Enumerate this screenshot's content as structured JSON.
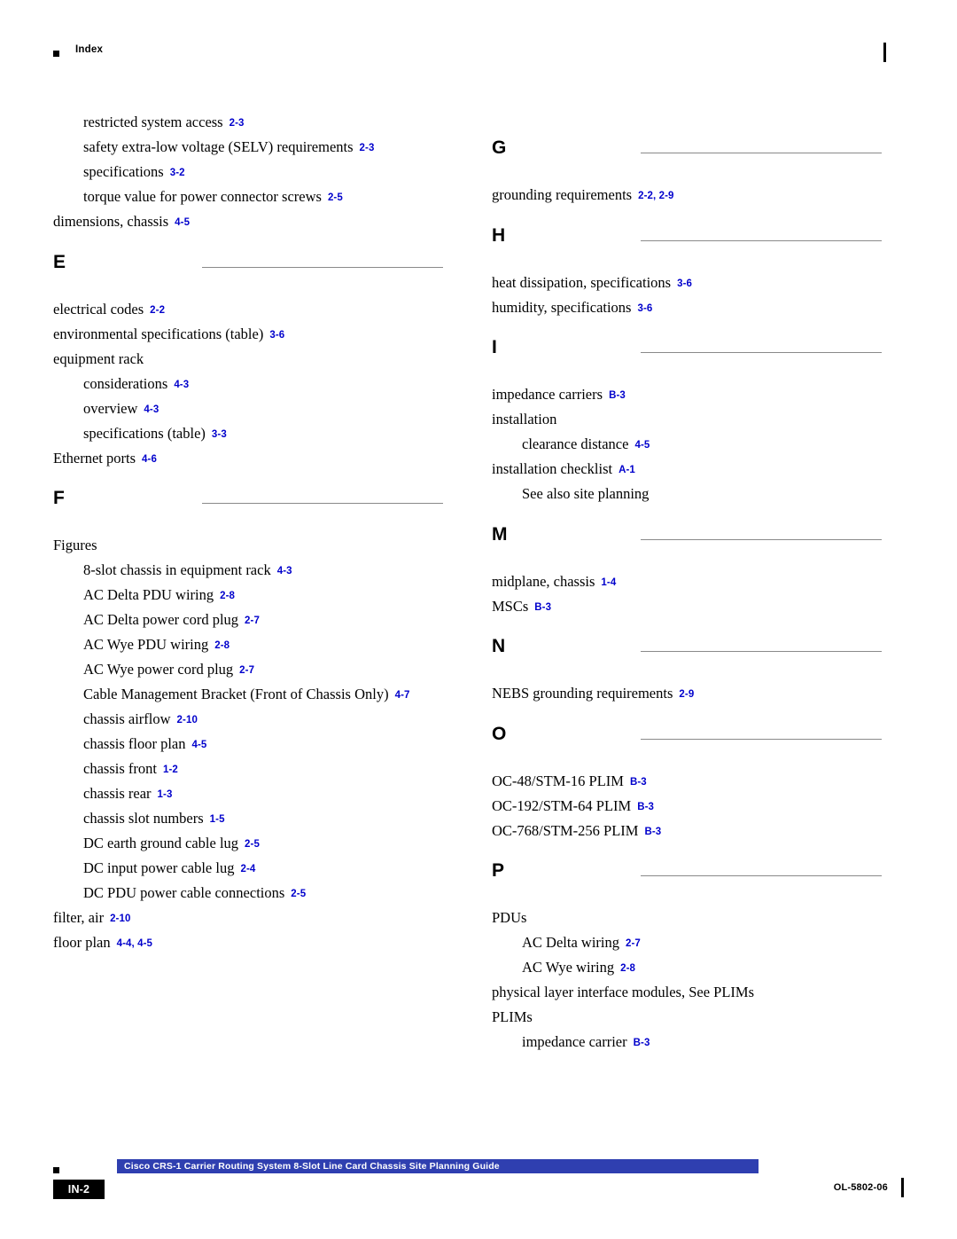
{
  "header": {
    "title": "Index"
  },
  "footer": {
    "bar_title": "Cisco CRS-1 Carrier Routing System 8-Slot Line Card Chassis Site Planning Guide",
    "page_badge": "IN-2",
    "doc_id": "OL-5802-06"
  },
  "colors": {
    "page_ref": "#0000CC",
    "footer_bar": "#2f3fb0",
    "rule": "#8a8a8a"
  },
  "left_column": {
    "continued_entries": [
      {
        "text": "restricted system access",
        "page": "2-3",
        "level": 1
      },
      {
        "text": "safety extra-low voltage (SELV) requirements",
        "page": "2-3",
        "level": 1
      },
      {
        "text": "specifications",
        "page": "3-2",
        "level": 1
      },
      {
        "text": "torque value for power connector screws",
        "page": "2-5",
        "level": 1
      },
      {
        "text": "dimensions, chassis",
        "page": "4-5",
        "level": 0
      }
    ],
    "sections": [
      {
        "letter": "E",
        "entries": [
          {
            "text": "electrical codes",
            "page": "2-2",
            "level": 0
          },
          {
            "text": "environmental specifications (table)",
            "page": "3-6",
            "level": 0
          },
          {
            "text": "equipment rack",
            "page": "",
            "level": 0
          },
          {
            "text": "considerations",
            "page": "4-3",
            "level": 1
          },
          {
            "text": "overview",
            "page": "4-3",
            "level": 1
          },
          {
            "text": "specifications (table)",
            "page": "3-3",
            "level": 1
          },
          {
            "text": "Ethernet ports",
            "page": "4-6",
            "level": 0
          }
        ]
      },
      {
        "letter": "F",
        "entries": [
          {
            "text": "Figures",
            "page": "",
            "level": 0
          },
          {
            "text": "8-slot chassis in equipment rack",
            "page": "4-3",
            "level": 1
          },
          {
            "text": "AC Delta PDU wiring",
            "page": "2-8",
            "level": 1
          },
          {
            "text": "AC Delta power cord plug",
            "page": "2-7",
            "level": 1
          },
          {
            "text": "AC Wye PDU wiring",
            "page": "2-8",
            "level": 1
          },
          {
            "text": "AC Wye power cord plug",
            "page": "2-7",
            "level": 1
          },
          {
            "text": "Cable Management Bracket (Front of Chassis Only)",
            "page": "4-7",
            "level": 1,
            "wrap": true
          },
          {
            "text": "chassis airflow",
            "page": "2-10",
            "level": 1
          },
          {
            "text": "chassis floor plan",
            "page": "4-5",
            "level": 1
          },
          {
            "text": "chassis front",
            "page": "1-2",
            "level": 1
          },
          {
            "text": "chassis rear",
            "page": "1-3",
            "level": 1
          },
          {
            "text": "chassis slot numbers",
            "page": "1-5",
            "level": 1
          },
          {
            "text": "DC earth ground cable lug",
            "page": "2-5",
            "level": 1
          },
          {
            "text": "DC input power cable lug",
            "page": "2-4",
            "level": 1
          },
          {
            "text": "DC PDU power cable connections",
            "page": "2-5",
            "level": 1
          },
          {
            "text": "filter, air",
            "page": "2-10",
            "level": 0
          },
          {
            "text": "floor plan",
            "page": "4-4, 4-5",
            "level": 0
          }
        ]
      }
    ]
  },
  "right_column": {
    "sections": [
      {
        "letter": "G",
        "entries": [
          {
            "text": "grounding requirements",
            "page": "2-2, 2-9",
            "level": 0
          }
        ]
      },
      {
        "letter": "H",
        "entries": [
          {
            "text": "heat dissipation, specifications",
            "page": "3-6",
            "level": 0
          },
          {
            "text": "humidity, specifications",
            "page": "3-6",
            "level": 0
          }
        ]
      },
      {
        "letter": "I",
        "entries": [
          {
            "text": "impedance carriers",
            "page": "B-3",
            "level": 0
          },
          {
            "text": "installation",
            "page": "",
            "level": 0
          },
          {
            "text": "clearance distance",
            "page": "4-5",
            "level": 1
          },
          {
            "text": "installation checklist",
            "page": "A-1",
            "level": 0
          },
          {
            "text": "See also site planning",
            "page": "",
            "level": 1
          }
        ]
      },
      {
        "letter": "M",
        "entries": [
          {
            "text": "midplane, chassis",
            "page": "1-4",
            "level": 0
          },
          {
            "text": "MSCs",
            "page": "B-3",
            "level": 0
          }
        ]
      },
      {
        "letter": "N",
        "entries": [
          {
            "text": "NEBS grounding requirements",
            "page": "2-9",
            "level": 0
          }
        ]
      },
      {
        "letter": "O",
        "entries": [
          {
            "text": "OC-48/STM-16 PLIM",
            "page": "B-3",
            "level": 0
          },
          {
            "text": "OC-192/STM-64 PLIM",
            "page": "B-3",
            "level": 0
          },
          {
            "text": "OC-768/STM-256 PLIM",
            "page": "B-3",
            "level": 0
          }
        ]
      },
      {
        "letter": "P",
        "entries": [
          {
            "text": "PDUs",
            "page": "",
            "level": 0
          },
          {
            "text": "AC Delta wiring",
            "page": "2-7",
            "level": 1
          },
          {
            "text": "AC Wye wiring",
            "page": "2-8",
            "level": 1
          },
          {
            "text": "physical layer interface modules, See PLIMs",
            "page": "",
            "level": 0
          },
          {
            "text": "PLIMs",
            "page": "",
            "level": 0
          },
          {
            "text": "impedance carrier",
            "page": "B-3",
            "level": 1
          }
        ]
      }
    ]
  }
}
